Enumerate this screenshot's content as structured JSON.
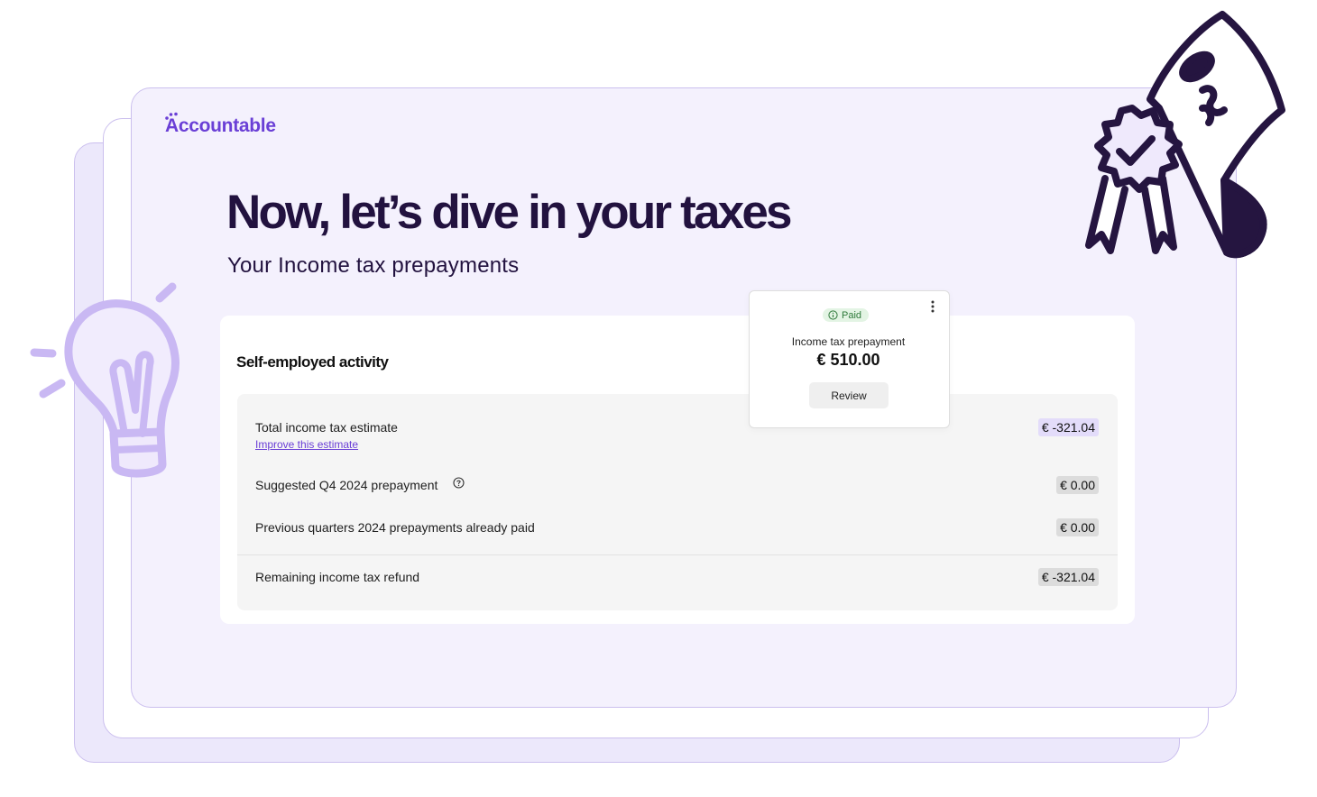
{
  "brand": {
    "name": "Accountable",
    "accent_color": "#6a3fd6"
  },
  "header": {
    "title": "Now, let’s dive in your taxes",
    "subtitle": "Your Income tax prepayments"
  },
  "section": {
    "title": "Self-employed activity",
    "rows": [
      {
        "label": "Total income tax estimate",
        "link": "Improve this estimate",
        "amount": "€ -321.04"
      },
      {
        "label": "Suggested Q4 2024 prepayment",
        "icon": "help-icon",
        "amount": "€ 0.00"
      },
      {
        "label": "Previous quarters 2024 prepayments already paid",
        "amount": "€ 0.00"
      },
      {
        "label": "Remaining income tax refund",
        "amount": "€ -321.04"
      }
    ]
  },
  "popup": {
    "status": "Paid",
    "status_color": "#2f7a3b",
    "label": "Income tax prepayment",
    "amount": "€ 510.00",
    "button": "Review",
    "menu_icon": "kebab-icon"
  },
  "illustrations": [
    "lightbulb-icon",
    "certificate-ribbon-icon"
  ]
}
